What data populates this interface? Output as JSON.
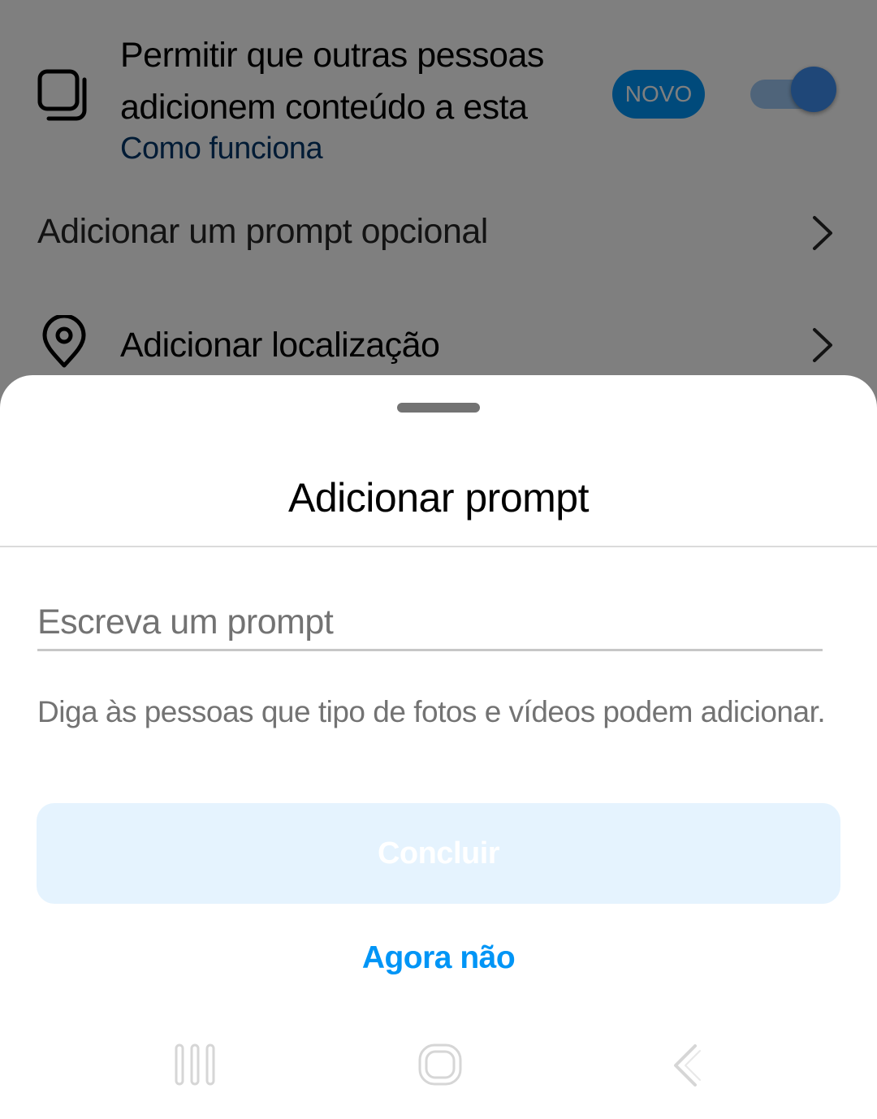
{
  "background": {
    "collab": {
      "title": "Permitir que outras pessoas adicionem conteúdo a esta",
      "link": "Como funciona",
      "badge": "NOVO",
      "toggle_on": true
    },
    "prompt_row": {
      "label": "Adicionar um prompt opcional"
    },
    "location_row": {
      "label": "Adicionar localização"
    }
  },
  "sheet": {
    "title": "Adicionar prompt",
    "input": {
      "placeholder": "Escreva um prompt",
      "value": ""
    },
    "helper": "Diga às pessoas que tipo de fotos e vídeos podem adicionar.",
    "done_label": "Concluir",
    "not_now_label": "Agora não"
  },
  "colors": {
    "accent": "#0095f6",
    "accent_disabled": "#e5f3fe",
    "link": "#00376b",
    "secondary_text": "#737373"
  }
}
